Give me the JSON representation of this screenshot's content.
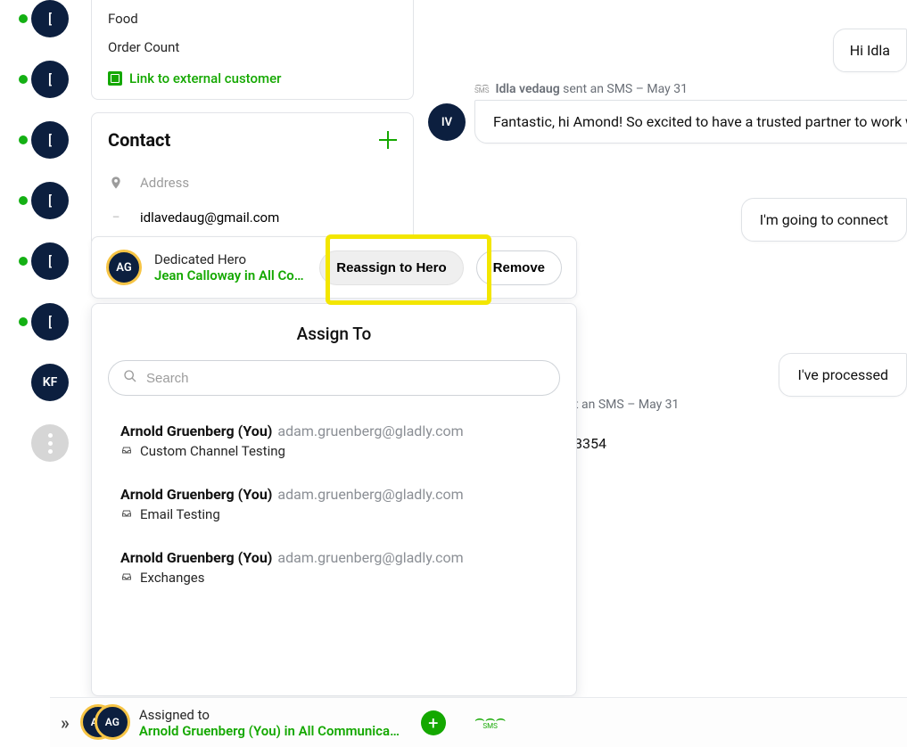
{
  "sidebar": {
    "avatar_label": "[",
    "avatar_count": 6,
    "kf_label": "KF"
  },
  "attrs_card": {
    "items": [
      "Food",
      "Order Count"
    ],
    "external_link": "Link to external customer"
  },
  "contact_card": {
    "title": "Contact",
    "address_placeholder": "Address",
    "email": "idlavedaug@gmail.com"
  },
  "hero": {
    "avatar_initials": "AG",
    "title": "Dedicated Hero",
    "subtitle": "Jean Calloway in All Commu…",
    "reassign_label": "Reassign to Hero",
    "remove_label": "Remove"
  },
  "assign": {
    "title": "Assign To",
    "search_placeholder": "Search",
    "options": [
      {
        "name": "Arnold Gruenberg (You)",
        "email": "adam.gruenberg@gladly.com",
        "channel": "Custom Channel Testing"
      },
      {
        "name": "Arnold Gruenberg (You)",
        "email": "adam.gruenberg@gladly.com",
        "channel": "Email Testing"
      },
      {
        "name": "Arnold Gruenberg (You)",
        "email": "adam.gruenberg@gladly.com",
        "channel": "Exchanges"
      }
    ]
  },
  "chat": {
    "meta1_sender": "Idla vedaug",
    "meta1_tail": " sent an SMS – May 31",
    "iv_initials": "IV",
    "bubble_out1": "Hi Idla",
    "bubble_in": "Fantastic, hi Amond! So excited to have a trusted partner to work with",
    "bubble_out2": "I'm going to connect",
    "bubble_out3": "I've processed",
    "meta2": "t an SMS – May 31",
    "big_num": "3354",
    "sms_caption": "SMS"
  },
  "footer": {
    "av1": "AG",
    "av2": "AG",
    "line1": "Assigned to",
    "line2": "Arnold Gruenberg (You) in All Communica…",
    "sms_caption": "SMS"
  }
}
